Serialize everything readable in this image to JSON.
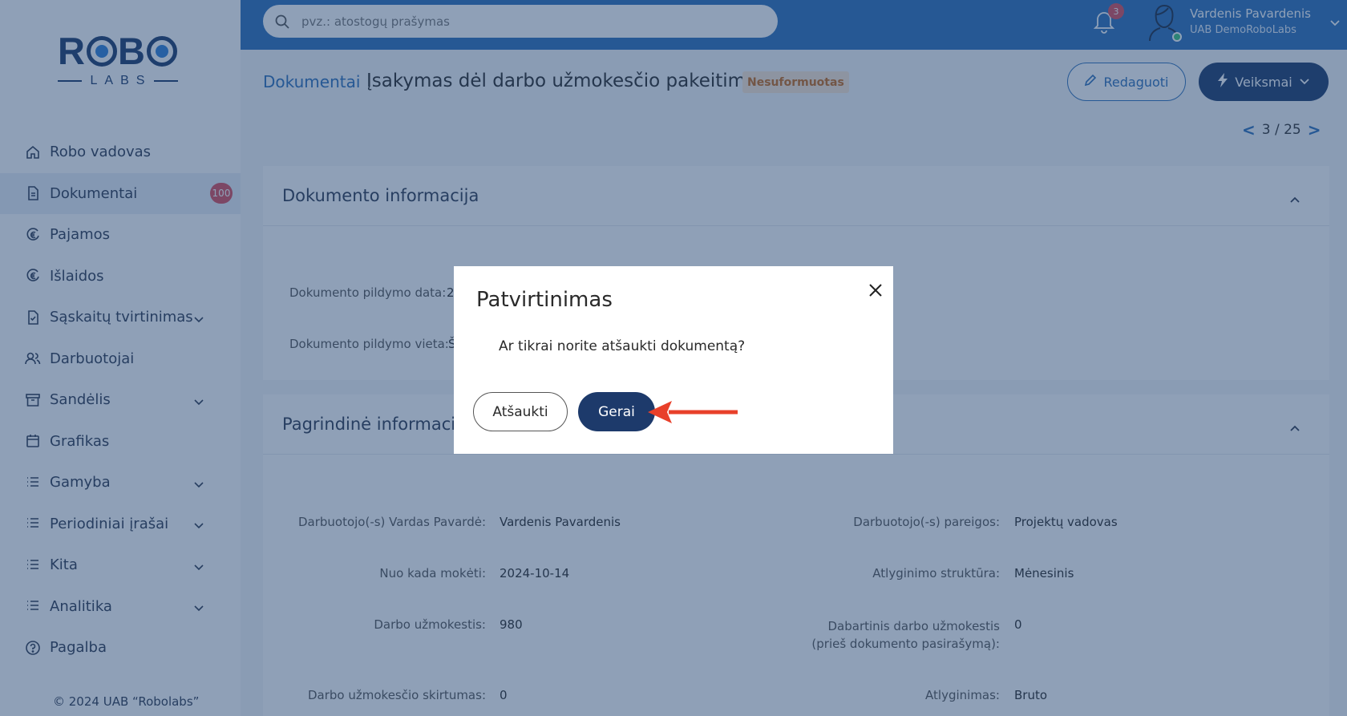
{
  "brand": {
    "logo_top": "ROBO",
    "logo_bottom": "LABS"
  },
  "sidebar": {
    "items": [
      {
        "label": "Robo vadovas",
        "icon": "home-icon"
      },
      {
        "label": "Dokumentai",
        "icon": "document-icon",
        "badge": "100",
        "active": true
      },
      {
        "label": "Pajamos",
        "icon": "euro-in-icon"
      },
      {
        "label": "Išlaidos",
        "icon": "euro-out-icon"
      },
      {
        "label": "Sąskaitų tvirtinimas",
        "icon": "document-check-icon",
        "expandable": true
      },
      {
        "label": "Darbuotojai",
        "icon": "users-icon"
      },
      {
        "label": "Sandėlis",
        "icon": "archive-icon",
        "expandable": true
      },
      {
        "label": "Grafikas",
        "icon": "calendar-icon"
      },
      {
        "label": "Gamyba",
        "icon": "list-icon",
        "expandable": true
      },
      {
        "label": "Periodiniai įrašai",
        "icon": "list-icon",
        "expandable": true
      },
      {
        "label": "Kita",
        "icon": "list-icon",
        "expandable": true
      },
      {
        "label": "Analitika",
        "icon": "list-icon",
        "expandable": true
      },
      {
        "label": "Pagalba",
        "icon": "help-icon"
      }
    ],
    "copyright": "© 2024 UAB “Robolabs”"
  },
  "topbar": {
    "search_placeholder": "pvz.: atostogų prašymas",
    "notifications_count": "3",
    "user_name": "Vardenis Pavardenis",
    "user_company": "UAB DemoRoboLabs"
  },
  "header": {
    "breadcrumb": "Dokumentai",
    "title": "Įsakymas dėl darbo užmokesčio pakeitimo",
    "status": "Nesuformuotas",
    "edit_label": "Redaguoti",
    "actions_label": "Veiksmai",
    "pager": "3 / 25",
    "pager_prev": "<",
    "pager_next": ">"
  },
  "doc_info": {
    "heading": "Dokumento informacija",
    "fields": [
      {
        "label": "Dokumento pildymo data:",
        "value": "2"
      },
      {
        "label": "Dokumento pildymo vieta:",
        "value": "Š"
      }
    ]
  },
  "main_info": {
    "heading": "Pagrindinė informacija",
    "fields": [
      {
        "label": "Darbuotojo(-s) Vardas Pavardė:",
        "value": "Vardenis Pavardenis"
      },
      {
        "label": "Darbuotojo(-s) pareigos:",
        "value": "Projektų vadovas"
      },
      {
        "label": "Nuo kada mokėti:",
        "value": "2024-10-14"
      },
      {
        "label": "Atlyginimo struktūra:",
        "value": "Mėnesinis"
      },
      {
        "label": "Darbo užmokestis:",
        "value": "980"
      },
      {
        "label": "Dabartinis darbo užmokestis (prieš dokumento pasirašymą):",
        "value": "0"
      },
      {
        "label": "Darbo užmokesčio skirtumas:",
        "value": "0"
      },
      {
        "label": "Atlyginimas:",
        "value": "Bruto"
      }
    ]
  },
  "modal": {
    "title": "Patvirtinimas",
    "message": "Ar tikrai norite atšaukti dokumentą?",
    "cancel_label": "Atšaukti",
    "ok_label": "Gerai"
  },
  "colors": {
    "primary": "#2c6fb8",
    "dark": "#1d3a6b",
    "badge": "#d94c5b",
    "status_bg": "#fbe6d2",
    "status_text": "#c66a1c",
    "annotation_arrow": "#e8402a"
  }
}
